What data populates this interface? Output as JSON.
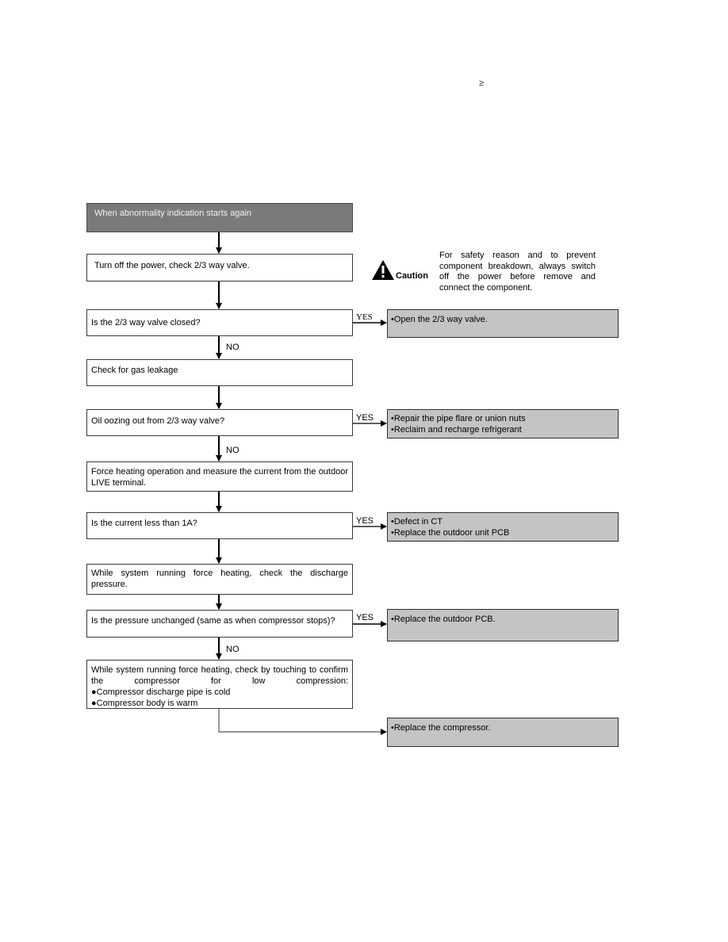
{
  "header": {
    "symbol": "≥"
  },
  "caution": {
    "icon": "warning-triangle-icon",
    "label": "Caution",
    "text": "For safety reason and to prevent component breakdown, always switch off the power before remove and connect the component."
  },
  "flow": {
    "start": "When abnormality indication starts again",
    "steps": [
      {
        "text": "Turn off the power, check 2/3 way valve."
      },
      {
        "text": "Is the 2/3 way valve closed?",
        "yes_label": "YES",
        "no_label": "NO",
        "result": [
          "•Open the 2/3 way valve."
        ]
      },
      {
        "text": "Check for gas leakage"
      },
      {
        "text": "Oil oozing out from 2/3 way valve?",
        "yes_label": "YES",
        "no_label": "NO",
        "result": [
          "•Repair the pipe flare or union nuts",
          "•Reclaim and recharge refrigerant"
        ]
      },
      {
        "text": "Force heating operation and measure the current from the outdoor LIVE terminal."
      },
      {
        "text": "Is the current less than 1A?",
        "yes_label": "YES",
        "result": [
          "•Defect in CT",
          "•Replace the outdoor unit PCB"
        ]
      },
      {
        "text": "While system running force heating, check the discharge pressure."
      },
      {
        "text": "Is the pressure unchanged (same as when compressor stops)?",
        "yes_label": "YES",
        "no_label": "NO",
        "result": [
          "•Replace the outdoor PCB."
        ]
      },
      {
        "text": "While system running force heating, check by touching to confirm the compressor for low compression:",
        "bullets": [
          "●Compressor discharge pipe is cold",
          "●Compressor body is warm"
        ],
        "result": [
          "•Replace the compressor."
        ]
      }
    ]
  }
}
